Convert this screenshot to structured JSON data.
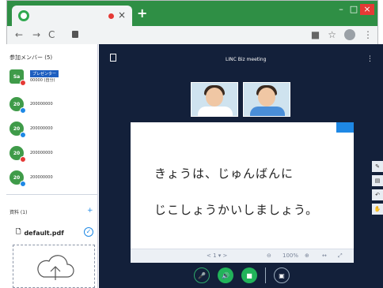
{
  "browser": {
    "tab_close": "×",
    "new_tab": "+",
    "nav": [
      "←",
      "→",
      "C"
    ],
    "win": [
      "–",
      "□",
      "×"
    ],
    "right_icons": [
      "■",
      "☆"
    ]
  },
  "members": {
    "header": "参加メンバー (5)",
    "list": [
      {
        "avatar": "Sa",
        "name": "00000 (自分)",
        "badge": "プレゼンター"
      },
      {
        "avatar": "20",
        "name": "200000000"
      },
      {
        "avatar": "20",
        "name": "200000000"
      },
      {
        "avatar": "20",
        "name": "200000000"
      },
      {
        "avatar": "20",
        "name": "200000000"
      }
    ]
  },
  "files": {
    "header": "資料 (1)",
    "add": "+",
    "file": "default.pdf"
  },
  "main": {
    "title": "LINC Biz meeting",
    "slide_lines": [
      "きょうは、じゅんばんに",
      "じこしょうかいしましょう。"
    ],
    "page": "< 1 ▾ >",
    "zoom": "100%"
  },
  "colors": {
    "brand": "#2f8f45",
    "bg_dark": "#13203a",
    "accent": "#1e88e5"
  }
}
